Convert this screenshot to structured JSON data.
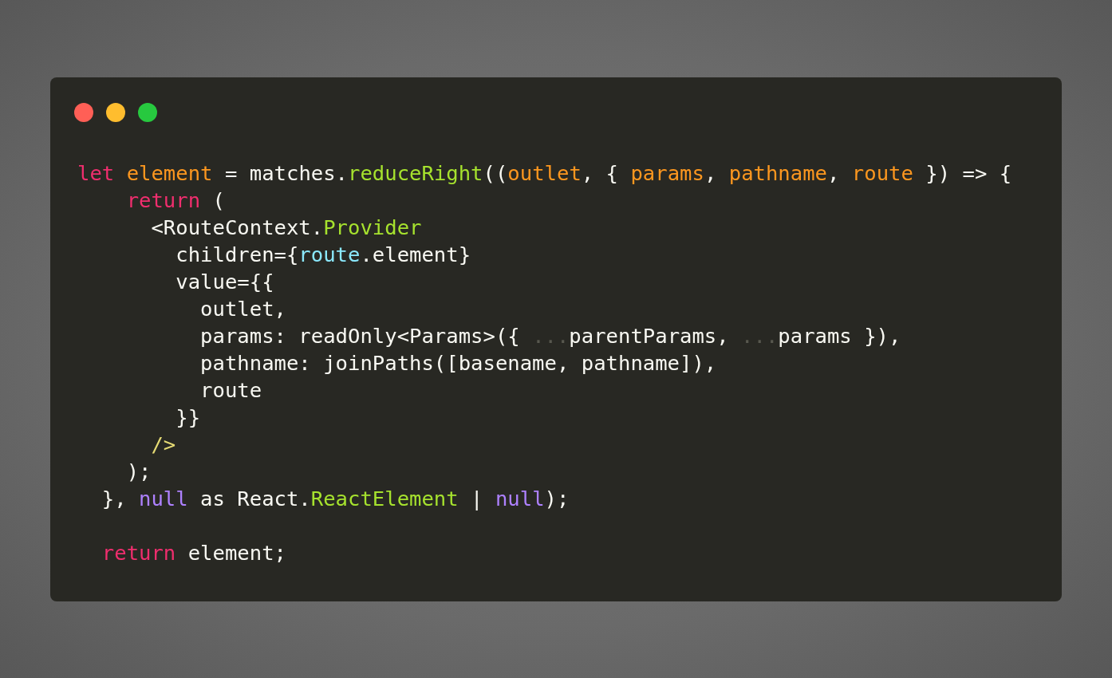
{
  "code_lines": [
    {
      "kind": "code",
      "tokens": [
        {
          "kind": "keyword",
          "text": "let "
        },
        {
          "kind": "param",
          "text": "element"
        },
        {
          "kind": "plain",
          "text": " = matches."
        },
        {
          "kind": "function",
          "text": "reduceRight"
        },
        {
          "kind": "plain",
          "text": "(("
        },
        {
          "kind": "param",
          "text": "outlet"
        },
        {
          "kind": "plain",
          "text": ", { "
        },
        {
          "kind": "param",
          "text": "params"
        },
        {
          "kind": "plain",
          "text": ", "
        },
        {
          "kind": "param",
          "text": "pathname"
        },
        {
          "kind": "plain",
          "text": ", "
        },
        {
          "kind": "param",
          "text": "route"
        },
        {
          "kind": "plain",
          "text": " }) => {"
        }
      ]
    },
    {
      "tokens": [
        {
          "kind": "keyword",
          "text": "    return"
        },
        {
          "kind": "plain",
          "text": " ("
        }
      ]
    },
    {
      "tokens": [
        {
          "kind": "plain",
          "text": "      <RouteContext."
        },
        {
          "kind": "function",
          "text": "Provider"
        }
      ]
    },
    {
      "tokens": [
        {
          "kind": "plain",
          "text": "        children={"
        },
        {
          "kind": "object",
          "text": "route"
        },
        {
          "kind": "plain",
          "text": ".element}"
        }
      ]
    },
    {
      "tokens": [
        {
          "kind": "plain",
          "text": "        value={{"
        }
      ]
    },
    {
      "tokens": [
        {
          "kind": "plain",
          "text": "          outlet,"
        }
      ]
    },
    {
      "tokens": [
        {
          "kind": "plain",
          "text": "          params: readOnly<Params>({ "
        },
        {
          "kind": "spread",
          "text": "..."
        },
        {
          "kind": "plain",
          "text": "parentParams, "
        },
        {
          "kind": "spread",
          "text": "..."
        },
        {
          "kind": "plain",
          "text": "params }),"
        }
      ]
    },
    {
      "tokens": [
        {
          "kind": "plain",
          "text": "          pathname: joinPaths([basename, pathname]),"
        }
      ]
    },
    {
      "tokens": [
        {
          "kind": "plain",
          "text": "          route"
        }
      ]
    },
    {
      "tokens": [
        {
          "kind": "plain",
          "text": "        }}"
        }
      ]
    },
    {
      "tokens": [
        {
          "kind": "tag",
          "text": "      />"
        }
      ]
    },
    {
      "tokens": [
        {
          "kind": "plain",
          "text": "    );"
        }
      ]
    },
    {
      "tokens": [
        {
          "kind": "plain",
          "text": "  }, "
        },
        {
          "kind": "literal",
          "text": "null"
        },
        {
          "kind": "plain",
          "text": " as React."
        },
        {
          "kind": "function",
          "text": "ReactElement"
        },
        {
          "kind": "plain",
          "text": " | "
        },
        {
          "kind": "literal",
          "text": "null"
        },
        {
          "kind": "plain",
          "text": ");"
        }
      ]
    },
    {
      "kind": "blank"
    },
    {
      "tokens": [
        {
          "kind": "keyword",
          "text": "  return"
        },
        {
          "kind": "plain",
          "text": " element;"
        }
      ]
    }
  ]
}
